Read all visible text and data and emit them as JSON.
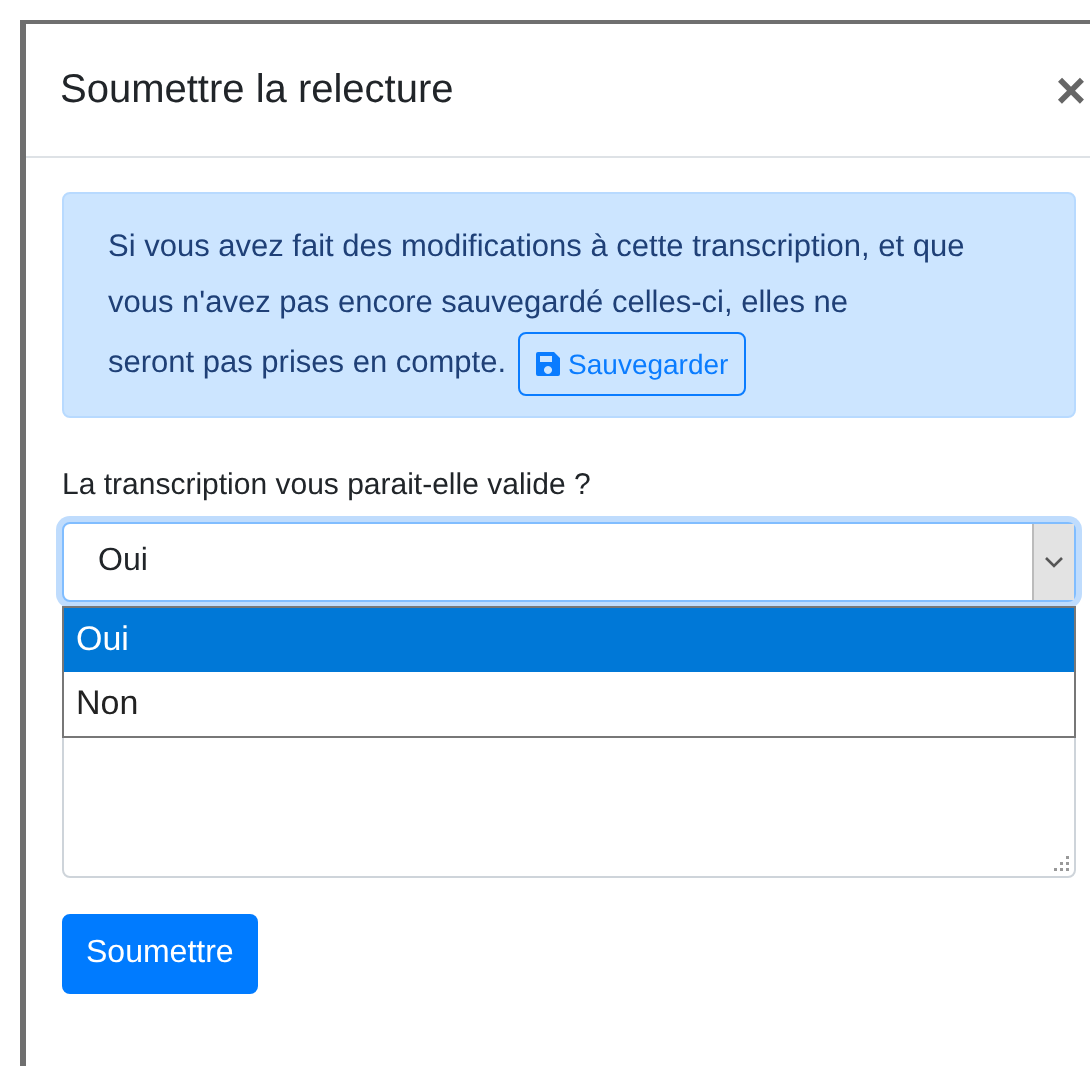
{
  "modal": {
    "title": "Soumettre la relecture",
    "close": "×"
  },
  "alert": {
    "text": "Si vous avez fait des modifications à cette transcription, et que vous n'avez pas encore sauvegardé celles-ci, elles ne",
    "text_end": "seront pas prises en compte.",
    "button": "Sauvegarder"
  },
  "question": {
    "label": "La transcription vous parait-elle valide ?",
    "value": "Oui",
    "expanded": true,
    "options": [
      {
        "label": "Oui",
        "selected": true
      },
      {
        "label": "Non",
        "selected": false
      }
    ]
  },
  "submit": "Soumettre"
}
